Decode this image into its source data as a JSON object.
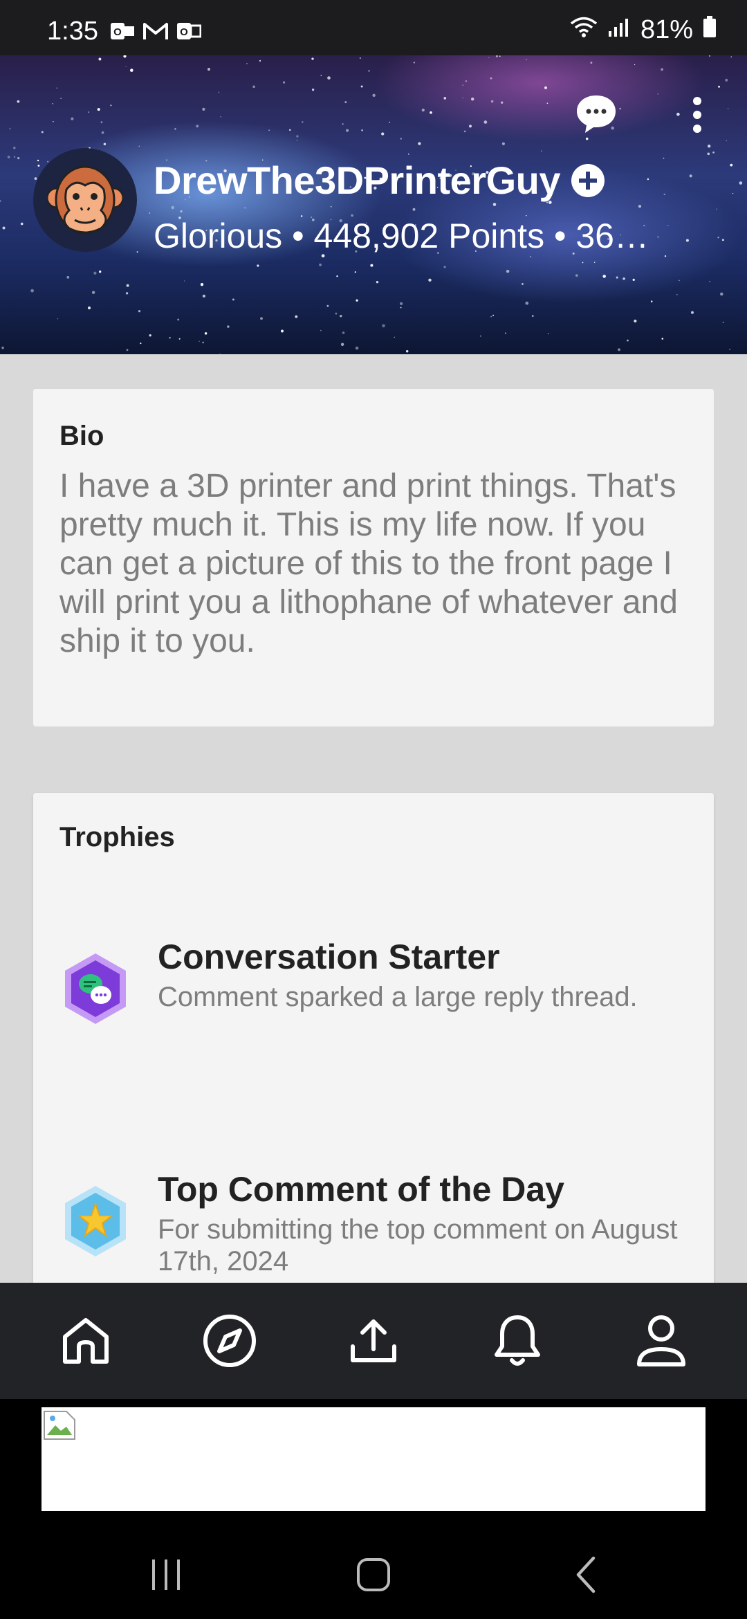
{
  "status_bar": {
    "time": "1:35",
    "battery": "81%",
    "icons": [
      "outlook-icon",
      "gmail-icon",
      "office-icon",
      "wifi-icon",
      "signal-icon",
      "battery-icon"
    ]
  },
  "profile": {
    "username": "DrewThe3DPrinterGuy",
    "stats": "Glorious • 448,902 Points • 36…",
    "avatar": "monkey-avatar-icon"
  },
  "bio": {
    "title": "Bio",
    "text": "I have a 3D printer and print things. That's pretty much it. This is my life now. If you can get a picture of this to the front page I will print you a lithophane of whatever and ship it to you."
  },
  "trophies": {
    "title": "Trophies",
    "items": [
      {
        "name": "Conversation Starter",
        "description": "Comment sparked a large reply thread.",
        "icon": "conversation-starter-trophy-icon",
        "color": "#8c4fe0"
      },
      {
        "name": "Top Comment of the Day",
        "description": "For submitting the top comment on August 17th, 2024",
        "icon": "top-comment-trophy-icon",
        "color": "#5bbde8"
      }
    ]
  },
  "bottom_nav": {
    "items": [
      "home-icon",
      "explore-icon",
      "upload-icon",
      "notifications-icon",
      "profile-icon"
    ]
  },
  "colors": {
    "status_bar_bg": "#1c1c1e",
    "page_bg": "#d9d9d9",
    "card_bg": "#f4f4f4",
    "nav_bg": "#222326",
    "text_primary": "#222222",
    "text_secondary": "#7d7d7d"
  }
}
